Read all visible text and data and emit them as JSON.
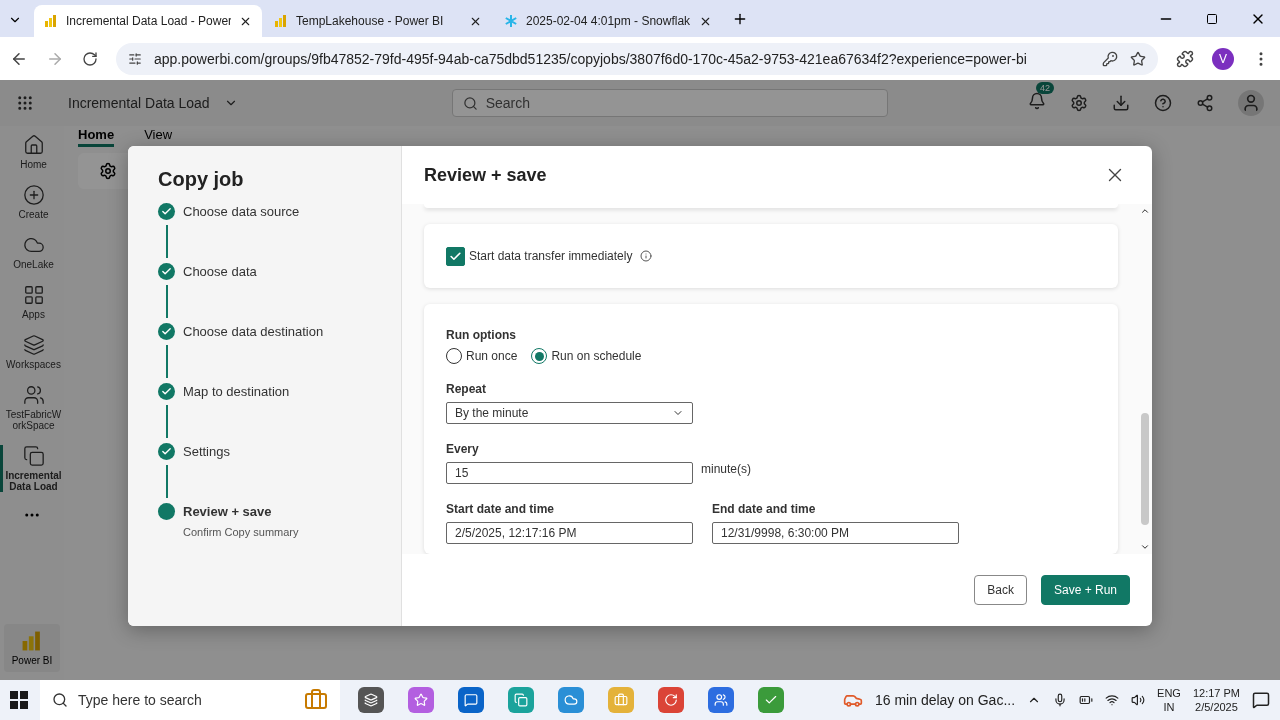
{
  "browser": {
    "tabs": [
      {
        "title": "Incremental Data Load - Power",
        "selected": true
      },
      {
        "title": "TempLakehouse - Power BI",
        "selected": false
      },
      {
        "title": "2025-02-04 4:01pm - Snowflak",
        "selected": false
      }
    ],
    "url": "app.powerbi.com/groups/9fb47852-79fd-495f-94ab-ca75dbd51235/copyjobs/3807f6d0-170c-45a2-9753-421ea67634f2?experience=power-bi",
    "profile": "V"
  },
  "app": {
    "title": "Incremental Data Load",
    "search_placeholder": "Search",
    "notification_count": "42",
    "nav": [
      {
        "label": "Home",
        "selected": false
      },
      {
        "label": "Create",
        "selected": false
      },
      {
        "label": "OneLake",
        "selected": false
      },
      {
        "label": "Apps",
        "selected": false
      },
      {
        "label": "Workspaces",
        "selected": false
      },
      {
        "label": "TestFabricW orkSpace",
        "selected": false
      },
      {
        "label": "Incremental Data Load",
        "selected": true
      }
    ],
    "ribbon_tabs": [
      {
        "label": "Home",
        "selected": true
      },
      {
        "label": "View",
        "selected": false
      }
    ],
    "footer": "Power BI"
  },
  "dialog": {
    "title": "Copy job",
    "steps": [
      {
        "label": "Choose data source",
        "done": true
      },
      {
        "label": "Choose data",
        "done": true
      },
      {
        "label": "Choose data destination",
        "done": true
      },
      {
        "label": "Map to destination",
        "done": true
      },
      {
        "label": "Settings",
        "done": true
      },
      {
        "label": "Review + save",
        "done": false,
        "subtitle": "Confirm Copy summary"
      }
    ],
    "panel_title": "Review + save",
    "start_immediately": {
      "label": "Start data transfer immediately",
      "checked": true
    },
    "run_options": {
      "label": "Run options",
      "options": [
        {
          "label": "Run once",
          "selected": false
        },
        {
          "label": "Run on schedule",
          "selected": true
        }
      ]
    },
    "repeat": {
      "label": "Repeat",
      "value": "By the minute"
    },
    "every": {
      "label": "Every",
      "value": "15",
      "unit": "minute(s)"
    },
    "start": {
      "label": "Start date and time",
      "value": "2/5/2025, 12:17:16 PM"
    },
    "end": {
      "label": "End date and time",
      "value": "12/31/9998, 6:30:00 PM"
    },
    "buttons": [
      {
        "label": "Back",
        "kind": "secondary"
      },
      {
        "label": "Save + Run",
        "kind": "primary"
      }
    ]
  },
  "taskbar": {
    "search_placeholder": "Type here to search",
    "news": "16 min delay on Gac...",
    "lang": "ENG",
    "region": "IN",
    "time": "12:17 PM",
    "date": "2/5/2025"
  }
}
